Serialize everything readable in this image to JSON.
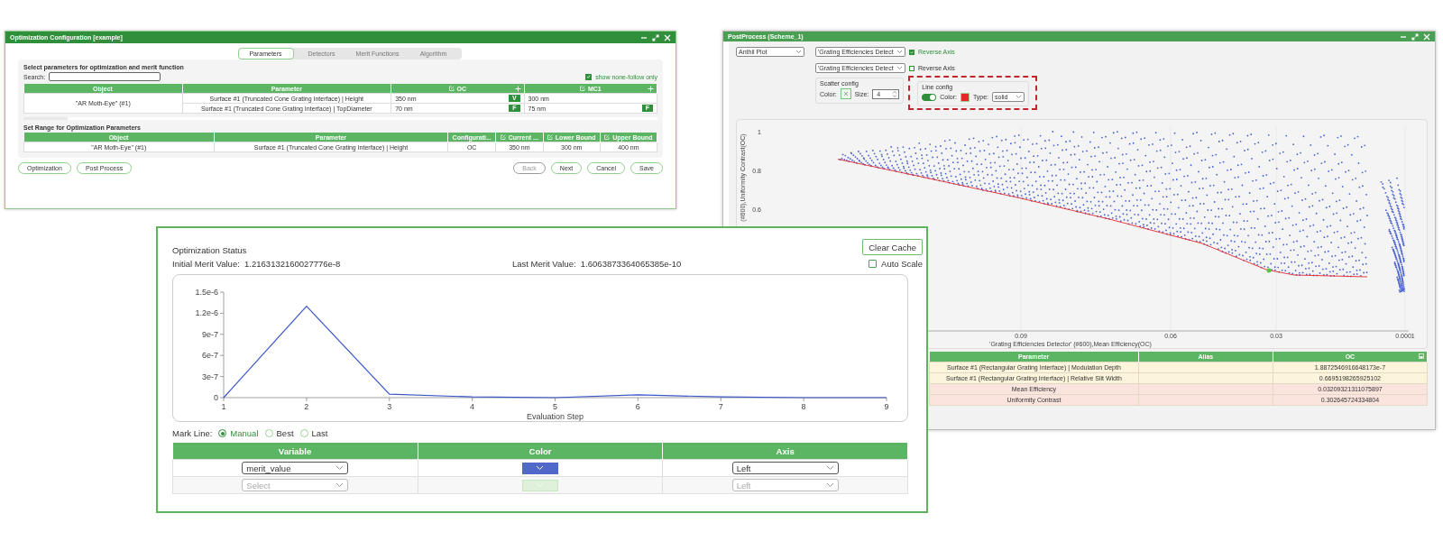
{
  "config_window": {
    "title": "Optimization Configuration [example]",
    "tabs": [
      {
        "label": "Parameters",
        "selected": true
      },
      {
        "label": "Detectors",
        "selected": false
      },
      {
        "label": "Merit Functions",
        "selected": false
      },
      {
        "label": "Algorithm",
        "selected": false
      }
    ],
    "section_title": "Select parameters for optimization and merit function",
    "search": {
      "label": "Search:"
    },
    "show_none_follow": {
      "label": "show none-follow only",
      "checked": true
    },
    "param_table": {
      "columns": [
        {
          "label": "Object",
          "kind": "plain"
        },
        {
          "label": "Parameter",
          "kind": "plain"
        },
        {
          "label": "OC",
          "kind": "configuration"
        },
        {
          "label": "MC1",
          "kind": "configuration"
        }
      ],
      "groups": [
        {
          "object": "\"AR Moth-Eye\"   (#1)",
          "rows": [
            {
              "parameter": "Surface #1 (Truncated Cone Grating Interface) | Height",
              "oc": "350 nm",
              "oc_flag": "V",
              "mc1": "300 nm"
            },
            {
              "parameter": "Surface #1 (Truncated Cone Grating Interface) | TopDiameter",
              "oc": "70 nm",
              "oc_flag": "F",
              "mc1": "75 nm",
              "mc1_flag": "F"
            }
          ]
        }
      ]
    },
    "range_title": "Set Range for Optimization Parameters",
    "range_table": {
      "columns": [
        {
          "label": "Object",
          "kind": "plain"
        },
        {
          "label": "Parameter",
          "kind": "plain"
        },
        {
          "label": "Configurati...",
          "kind": "plain"
        },
        {
          "label": "Current ...",
          "kind": "editable"
        },
        {
          "label": "Lower Bound",
          "kind": "editable"
        },
        {
          "label": "Upper Bound",
          "kind": "editable"
        }
      ],
      "rows": [
        {
          "cells": [
            "\"AR Moth-Eye\"   (#1)",
            "Surface #1 (Truncated Cone Grating Interface) | Height",
            "OC",
            "350 nm",
            "300 nm",
            "400 nm"
          ]
        }
      ]
    },
    "left_buttons": [
      {
        "label": "Optimization",
        "disabled": false
      },
      {
        "label": "Post Process",
        "disabled": false
      }
    ],
    "right_buttons": [
      {
        "label": "Back",
        "disabled": true
      },
      {
        "label": "Next",
        "disabled": false
      },
      {
        "label": "Cancel",
        "disabled": false
      },
      {
        "label": "Save",
        "disabled": false
      }
    ]
  },
  "post_window": {
    "title": "PostProcess (Scheme_1)",
    "plot_type": "Anthil Plot",
    "axes": [
      {
        "detector": "'Grating Efficiencies Detect",
        "reverse": {
          "label": "Reverse Axis",
          "checked": true
        }
      },
      {
        "detector": "'Grating Efficiencies Detect",
        "reverse": {
          "label": "Reverse Axis",
          "checked": false
        }
      }
    ],
    "scatter_config": {
      "legend": "Scatter config",
      "color_label": "Color:",
      "size_label": "Size:",
      "size": "4"
    },
    "line_config": {
      "legend": "Line config",
      "on": true,
      "color_label": "Color:",
      "color": "#e8262a",
      "type_label": "Type:",
      "type": "solid",
      "highlighted": true
    },
    "plot": {
      "y_label": "(#600),Uniformity Contrast(OC)",
      "x_label": "'Grating Efficiencies Detector'   (#600),Mean Efficiency(OC)",
      "y_ticks": [
        "1",
        "0.8",
        "0.6"
      ],
      "x_ticks": [
        "0.09",
        "0.06",
        "0.03",
        "0.0001"
      ]
    },
    "result_table": {
      "columns": [
        "Parameter",
        "Alias",
        "OC"
      ],
      "rows": [
        {
          "kind": "parameter",
          "parameter": "Surface #1 (Rectangular Grating Interface) | Modulation Depth",
          "oc": "1.8872546916648173e-7"
        },
        {
          "kind": "parameter",
          "parameter": "Surface #1 (Rectangular Grating Interface) | Relative Slit Width",
          "oc": "0.6695198265925102"
        },
        {
          "kind": "merit",
          "parameter": "Mean Efficiency",
          "oc": "0.03209321311075897"
        },
        {
          "kind": "merit",
          "parameter": "Uniformity Contrast",
          "oc": "0.302645724334804"
        }
      ]
    }
  },
  "status_window": {
    "title": "Optimization Status",
    "clear_button": "Clear Cache",
    "initial": {
      "label": "Initial Merit Value:",
      "value": "1.2163132160027776e-8"
    },
    "last": {
      "label": "Last Merit Value:",
      "value": "1.6063873364065385e-10"
    },
    "auto_scale": {
      "label": "Auto Scale",
      "checked": false
    },
    "chart_data": {
      "type": "line",
      "xlabel": "Evaluation Step",
      "x": [
        1,
        2,
        3,
        4,
        5,
        6,
        7,
        8,
        9
      ],
      "series": [
        {
          "color": "#3a55c8",
          "values": [
            0,
            1.3e-06,
            5e-08,
            1e-08,
            0,
            4e-08,
            1e-08,
            0,
            0
          ]
        }
      ],
      "xlim": [
        1,
        9
      ],
      "ylim": [
        0,
        1.5e-06
      ],
      "xticks": [
        1,
        2,
        3,
        4,
        5,
        6,
        7,
        8,
        9
      ],
      "yticks": [
        {
          "value": 0,
          "label": "0"
        },
        {
          "value": 3e-07,
          "label": "3e-7"
        },
        {
          "value": 6e-07,
          "label": "6e-7"
        },
        {
          "value": 9e-07,
          "label": "9e-7"
        },
        {
          "value": 1.2e-06,
          "label": "1.2e-6"
        },
        {
          "value": 1.5e-06,
          "label": "1.5e-6"
        }
      ]
    },
    "mark_line": {
      "label": "Mark Line:",
      "options": [
        {
          "label": "Manual",
          "selected": true
        },
        {
          "label": "Best",
          "selected": false
        },
        {
          "label": "Last",
          "selected": false
        }
      ]
    },
    "variable_table": {
      "columns": [
        "Variable",
        "Color",
        "Axis"
      ],
      "rows": [
        {
          "variable": "merit_value",
          "color": "#4f68c9",
          "axis": "Left",
          "disabled": false
        },
        {
          "placeholder": "Select",
          "axis": "Left",
          "disabled": true
        }
      ]
    }
  }
}
